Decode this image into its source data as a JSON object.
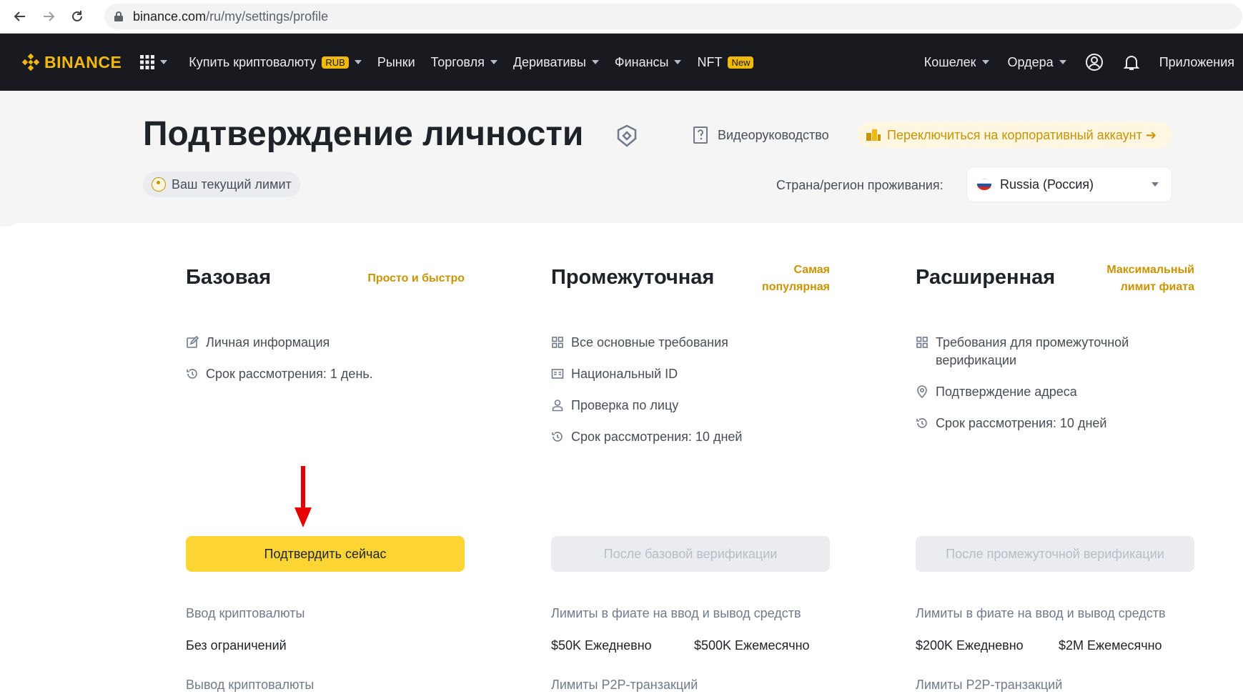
{
  "browser": {
    "url_host": "binance.com",
    "url_path": "/ru/my/settings/profile"
  },
  "header": {
    "brand": "BINANCE",
    "nav": [
      {
        "label": "Купить криптовалюту",
        "badge": "RUB",
        "dropdown": true
      },
      {
        "label": "Рынки",
        "dropdown": false
      },
      {
        "label": "Торговля",
        "dropdown": true
      },
      {
        "label": "Деривативы",
        "dropdown": true
      },
      {
        "label": "Финансы",
        "dropdown": true
      },
      {
        "label": "NFT",
        "badge": "New",
        "dropdown": false
      }
    ],
    "right": {
      "wallet": "Кошелек",
      "orders": "Ордера",
      "apps": "Приложения"
    }
  },
  "page": {
    "title": "Подтверждение личности",
    "video_guide": "Видеоруководство",
    "switch_corporate": "Переключиться на корпоративный аккаунт ➔",
    "current_limit": "Ваш текущий лимит",
    "country_label": "Страна/регион проживания:",
    "country_value": "Russia (Россия)"
  },
  "levels": [
    {
      "title": "Базовая",
      "tag_lines": [
        "Просто и быстро"
      ],
      "requirements": [
        {
          "icon": "edit-icon",
          "text": "Личная информация"
        },
        {
          "icon": "clock-icon",
          "text": "Срок рассмотрения: 1 день."
        }
      ],
      "cta": "Подтвердить сейчас",
      "cta_enabled": true,
      "limit1_label": "Ввод криптовалюты",
      "limit1_values": [
        "Без ограничений"
      ],
      "limit2_label": "Вывод криптовалюты"
    },
    {
      "title": "Промежуточная",
      "tag_lines": [
        "Самая",
        "популярная"
      ],
      "requirements": [
        {
          "icon": "grid-icon",
          "text": "Все основные требования"
        },
        {
          "icon": "id-card-icon",
          "text": "Национальный ID"
        },
        {
          "icon": "person-icon",
          "text": "Проверка по лицу"
        },
        {
          "icon": "clock-icon",
          "text": "Срок рассмотрения: 10 дней"
        }
      ],
      "cta": "После базовой верификации",
      "cta_enabled": false,
      "limit1_label": "Лимиты в фиате на ввод и вывод средств",
      "limit1_values": [
        "$50K Ежедневно",
        "$500K Ежемесячно"
      ],
      "limit2_label": "Лимиты P2P-транзакций"
    },
    {
      "title": "Расширенная",
      "tag_lines": [
        "Максимальный",
        "лимит фиата"
      ],
      "requirements": [
        {
          "icon": "grid-icon",
          "text": "Требования для промежуточной верификации"
        },
        {
          "icon": "location-icon",
          "text": "Подтверждение адреса"
        },
        {
          "icon": "clock-icon",
          "text": "Срок рассмотрения: 10 дней"
        }
      ],
      "cta": "После промежуточной верификации",
      "cta_enabled": false,
      "limit1_label": "Лимиты в фиате на ввод и вывод средств",
      "limit1_values": [
        "$200K Ежедневно",
        "$2M Ежемесячно"
      ],
      "limit2_label": "Лимиты P2P-транзакций"
    }
  ],
  "colors": {
    "brand": "#f0b90b",
    "primary_button": "#fcd535",
    "accent_text": "#c99400",
    "annotation_arrow": "#e60000"
  }
}
